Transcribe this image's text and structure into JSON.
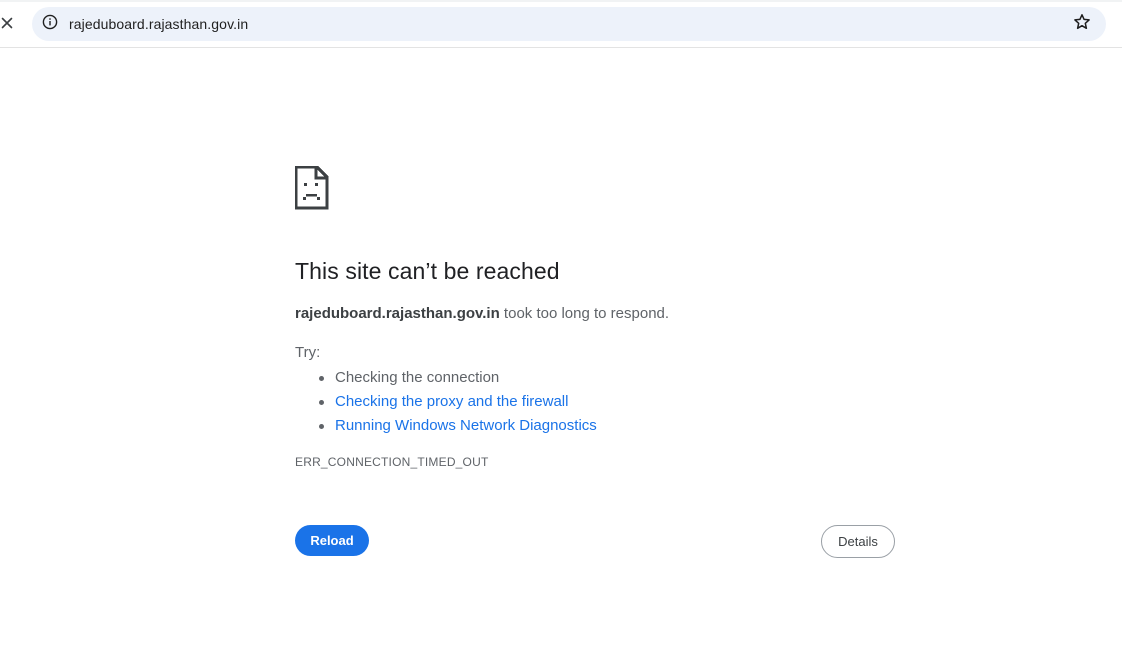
{
  "toolbar": {
    "stop_icon": "close-icon",
    "site_info_icon": "info-icon",
    "url": "rajeduboard.rajasthan.gov.in",
    "bookmark_icon": "star-icon"
  },
  "error": {
    "icon": "sad-document-icon",
    "heading": "This site can’t be reached",
    "host": "rajeduboard.rajasthan.gov.in",
    "message": " took too long to respond.",
    "try_label": "Try:",
    "suggestions": [
      {
        "label": "Checking the connection",
        "link": false
      },
      {
        "label": "Checking the proxy and the firewall",
        "link": true
      },
      {
        "label": "Running Windows Network Diagnostics",
        "link": true
      }
    ],
    "code": "ERR_CONNECTION_TIMED_OUT"
  },
  "buttons": {
    "reload_label": "Reload",
    "details_label": "Details"
  },
  "colors": {
    "accent": "#1a73e8",
    "omnibox_bg": "#edf2fa",
    "text_secondary": "#5f6368"
  }
}
